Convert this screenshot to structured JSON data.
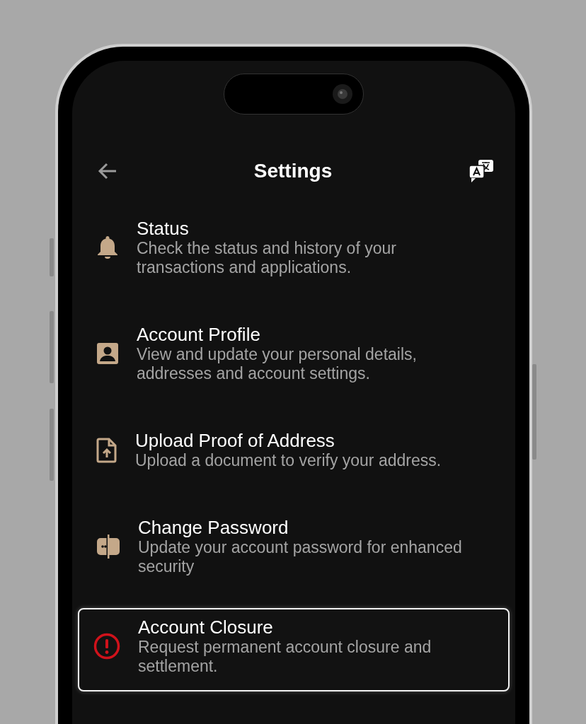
{
  "header": {
    "title": "Settings"
  },
  "items": [
    {
      "kind": "bell",
      "title": "Status",
      "description": "Check the status and history of your transactions and applications.",
      "selected": false
    },
    {
      "kind": "profile",
      "title": "Account Profile",
      "description": "View and update your personal details, addresses and account settings.",
      "selected": false
    },
    {
      "kind": "upload",
      "title": "Upload Proof of Address",
      "description": "Upload a document to verify your address.",
      "selected": false
    },
    {
      "kind": "password",
      "title": "Change Password",
      "description": "Update your account password for enhanced security",
      "selected": false
    },
    {
      "kind": "warning",
      "title": "Account Closure",
      "description": "Request permanent account closure and settlement.",
      "selected": true
    }
  ]
}
